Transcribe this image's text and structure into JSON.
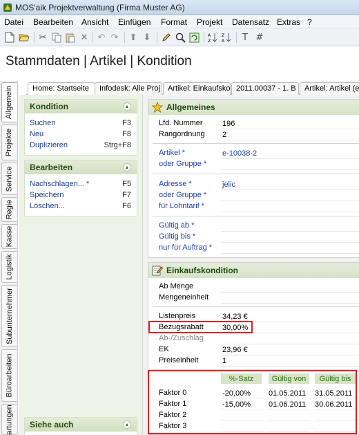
{
  "window": {
    "title": "MOS'aik Projektverwaltung (Firma Muster AG)"
  },
  "menu": [
    "Datei",
    "Bearbeiten",
    "Ansicht",
    "Einfügen",
    "Format",
    "Projekt",
    "Datensatz",
    "Extras",
    "?"
  ],
  "toolbar": {
    "icons": [
      "new-document-icon",
      "open-folder-icon",
      "cut-icon",
      "copy-icon",
      "paste-icon",
      "delete-icon",
      "undo-icon",
      "redo-icon",
      "arrow-up-icon",
      "arrow-down-icon",
      "edit-pencil-icon",
      "search-icon",
      "refresh-icon",
      "sort-az-icon",
      "sort-za-icon",
      "text-icon",
      "hash-icon"
    ]
  },
  "page_title": "Stammdaten | Artikel | Kondition",
  "vertical_tabs": [
    "Allgemein",
    "Projekte",
    "Service",
    "Regie",
    "Kasse",
    "Logistik",
    "Subunternehmer",
    "Büroarbeiten",
    "artungen"
  ],
  "top_tabs": [
    "Home: Startseite",
    "Infodesk: Alle Proj",
    "Artikel: Einkaufsko",
    "2011.00037 - 1. B",
    "Artikel: Artikel (e"
  ],
  "left_panel": {
    "kondition": {
      "title": "Kondition",
      "items": [
        {
          "label": "Suchen",
          "key": "F3"
        },
        {
          "label": "Neu",
          "key": "F8"
        },
        {
          "label": "Duplizieren",
          "key": "Strg+F8"
        }
      ]
    },
    "bearbeiten": {
      "title": "Bearbeiten",
      "items": [
        {
          "label": "Nachschlagen... *",
          "key": "F5"
        },
        {
          "label": "Speichern",
          "key": "F7"
        },
        {
          "label": "Löschen...",
          "key": "F6"
        }
      ]
    },
    "siehe_auch": {
      "title": "Siehe auch"
    }
  },
  "allgemeines": {
    "title": "Allgemeines",
    "lfd_nummer": {
      "label": "Lfd. Nummer",
      "value": "196"
    },
    "rangordnung": {
      "label": "Rangordnung",
      "value": "2"
    },
    "artikel": {
      "label": "Artikel *",
      "value": "e-10038-2"
    },
    "oder_gruppe_1": {
      "label": "oder Gruppe *",
      "value": ""
    },
    "adresse": {
      "label": "Adresse *",
      "value": "jelic"
    },
    "oder_gruppe_2": {
      "label": "oder Gruppe *",
      "value": ""
    },
    "fuer_lohntarif": {
      "label": "für Lohntarif *",
      "value": ""
    },
    "gueltig_ab": {
      "label": "Gültig ab *",
      "value": ""
    },
    "gueltig_bis": {
      "label": "Gültig bis *",
      "value": ""
    },
    "nur_fuer_auftrag": {
      "label": "nur für Auftrag *",
      "value": ""
    }
  },
  "einkaufskondition": {
    "title": "Einkaufskondition",
    "ab_menge": {
      "label": "Ab Menge",
      "value": ""
    },
    "mengeneinheit": {
      "label": "Mengeneinheit",
      "value": ""
    },
    "listenpreis": {
      "label": "Listenpreis",
      "value": "34,23 €"
    },
    "bezugsrabatt": {
      "label": "Bezugsrabatt",
      "value": "30,00%"
    },
    "ab_zuschlag": {
      "label": "Ab-/Zuschlag",
      "value": ""
    },
    "ek": {
      "label": "EK",
      "value": "23,96 €"
    },
    "preiseinheit": {
      "label": "Preiseinheit",
      "value": "1"
    }
  },
  "faktoren": {
    "headers": [
      "%-Satz",
      "Gültig von",
      "Gültig bis"
    ],
    "rows": [
      {
        "label": "Faktor 0",
        "satz": "-20,00%",
        "von": "01.05.2011",
        "bis": "31.05.2011"
      },
      {
        "label": "Faktor 1",
        "satz": "-15,00%",
        "von": "01.06.2011",
        "bis": "30.06.2011"
      },
      {
        "label": "Faktor 2",
        "satz": "",
        "von": "",
        "bis": ""
      },
      {
        "label": "Faktor 3",
        "satz": "",
        "von": "",
        "bis": ""
      }
    ]
  },
  "colors": {
    "highlight_border": "#e02020",
    "section_header": "#d6e2c7",
    "link_blue": "#2040a8"
  }
}
